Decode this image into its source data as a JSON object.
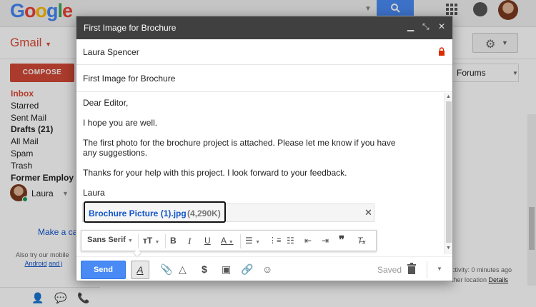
{
  "google_logo": "Google",
  "header": {
    "app_label": "Gmail"
  },
  "sidebar": {
    "compose_label": "COMPOSE",
    "items": [
      {
        "label": "Inbox"
      },
      {
        "label": "Starred"
      },
      {
        "label": "Sent Mail"
      },
      {
        "label": "Drafts (21)"
      },
      {
        "label": "All Mail"
      },
      {
        "label": "Spam"
      },
      {
        "label": "Trash"
      },
      {
        "label": "Former Employ"
      }
    ],
    "hangout_user": "Laura",
    "make_call": "Make a ca",
    "mobile_app_line1": "Also try our mobile",
    "mobile_app_link1": "Android",
    "mobile_app_link2": "and j"
  },
  "tabs": {
    "forums": "Forums"
  },
  "activity": {
    "line1": "ctivity: 0 minutes ago",
    "line2": "ther location",
    "details": "Details"
  },
  "compose": {
    "title": "First Image for Brochure",
    "to": "Laura Spencer",
    "subject": "First Image for Brochure",
    "body": [
      "Dear Editor,",
      "I hope you are well.",
      "The first photo for the brochure project is attached. Please let me know if you have any suggestions.",
      "Thanks for your help with this project. I look forward to your feedback.",
      "Laura"
    ],
    "attachment": {
      "name": "Brochure Picture (1).jpg",
      "size": "(4,290K)"
    },
    "format_bar": {
      "font": "Sans Serif"
    },
    "send_label": "Send",
    "saved_label": "Saved"
  },
  "colors": {
    "send_blue": "#4a8af4",
    "compose_red": "#d14836",
    "header_dark": "#404040",
    "link_blue": "#1155cc"
  }
}
